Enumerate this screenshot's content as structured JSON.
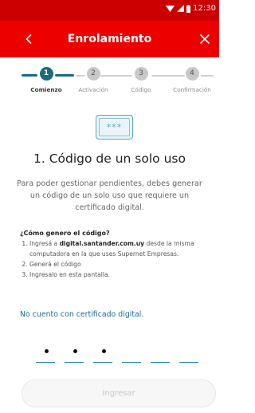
{
  "statusbar": {
    "time": "12:30"
  },
  "header": {
    "title": "Enrolamiento"
  },
  "steps": [
    {
      "number": "1",
      "label": "Comienzo",
      "state": "active"
    },
    {
      "number": "2",
      "label": "Activación",
      "state": "pending"
    },
    {
      "number": "3",
      "label": "Código",
      "state": "pending"
    },
    {
      "number": "4",
      "label": "Confirmación",
      "state": "pending"
    }
  ],
  "badge": {
    "text": "***"
  },
  "main": {
    "title": "1. Código de un solo uso",
    "description": "Para poder gestionar pendientes, debes generar un código de un solo uso que requiere un certificado digital."
  },
  "howto": {
    "title": "¿Cómo genero el código?",
    "step1_prefix": "Ingresá a ",
    "step1_link": "digital.santander.com.uy",
    "step1_suffix": " desde la misma computadora en la que uses Supernet Empresas.",
    "step2": "Generá el código",
    "step3": "Ingresalo en esta pantalla."
  },
  "no_cert_link": "No cuento con certificado digital.",
  "otp": {
    "length": 6,
    "filled": 3
  },
  "submit_label": "Ingresar",
  "colors": {
    "brand_red": "#ec0000",
    "accent_teal": "#1a6b80",
    "link_blue": "#1a6b9a"
  }
}
